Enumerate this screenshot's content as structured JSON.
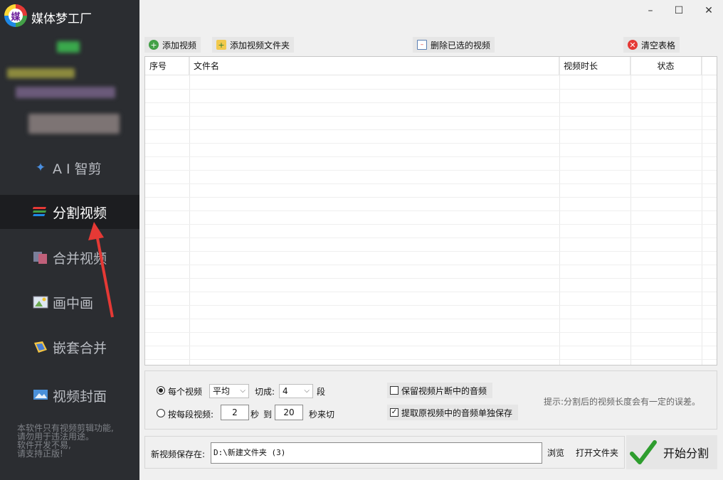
{
  "app": {
    "logo_char": "媒",
    "title": "媒体梦工厂"
  },
  "sidebar": {
    "items": [
      {
        "label": "A I 智剪",
        "icon": "ai-clip-icon"
      },
      {
        "label": "分割视频",
        "icon": "split-video-icon",
        "active": true
      },
      {
        "label": "合并视频",
        "icon": "merge-video-icon"
      },
      {
        "label": "画中画",
        "icon": "picture-in-picture-icon"
      },
      {
        "label": "嵌套合并",
        "icon": "nest-merge-icon"
      },
      {
        "label": "视频封面",
        "icon": "video-cover-icon"
      }
    ],
    "notice_lines": [
      "本软件只有视频剪辑功能,",
      "请勿用于违法用途。",
      "软件开发不易,",
      "请支持正版!"
    ]
  },
  "window": {
    "minimize": "–",
    "maximize": "☐",
    "close": "✕"
  },
  "toolbar": {
    "add_video": "添加视频",
    "add_folder": "添加视频文件夹",
    "delete_selected": "删除已选的视频",
    "clear_table": "清空表格"
  },
  "table": {
    "columns": [
      "序号",
      "文件名",
      "视频时长",
      "状态"
    ],
    "rows": []
  },
  "options": {
    "mode_each": "每个视频",
    "mode_each_method": "平均",
    "cut_into_label": "切成:",
    "segments": "4",
    "segment_unit": "段",
    "mode_per_segment": "按每段视频:",
    "from_seconds": "2",
    "sec_label": "秒",
    "to_label": "到",
    "to_seconds": "20",
    "random_cut_label": "秒来切",
    "keep_audio": "保留视频片断中的音频",
    "keep_audio_checked": false,
    "extract_audio": "提取原视频中的音频单独保存",
    "extract_audio_checked": true,
    "hint": "提示:分割后的视频长度会有一定的误差。"
  },
  "save": {
    "label": "新视频保存在:",
    "path": "D:\\新建文件夹 (3)",
    "browse": "浏览",
    "open_folder": "打开文件夹"
  },
  "start_button": "开始分割",
  "colors": {
    "sidebar_bg": "#2b2d31",
    "active_bg": "#1c1d20",
    "arrow": "#e53935",
    "check_green": "#2e9d2e"
  }
}
